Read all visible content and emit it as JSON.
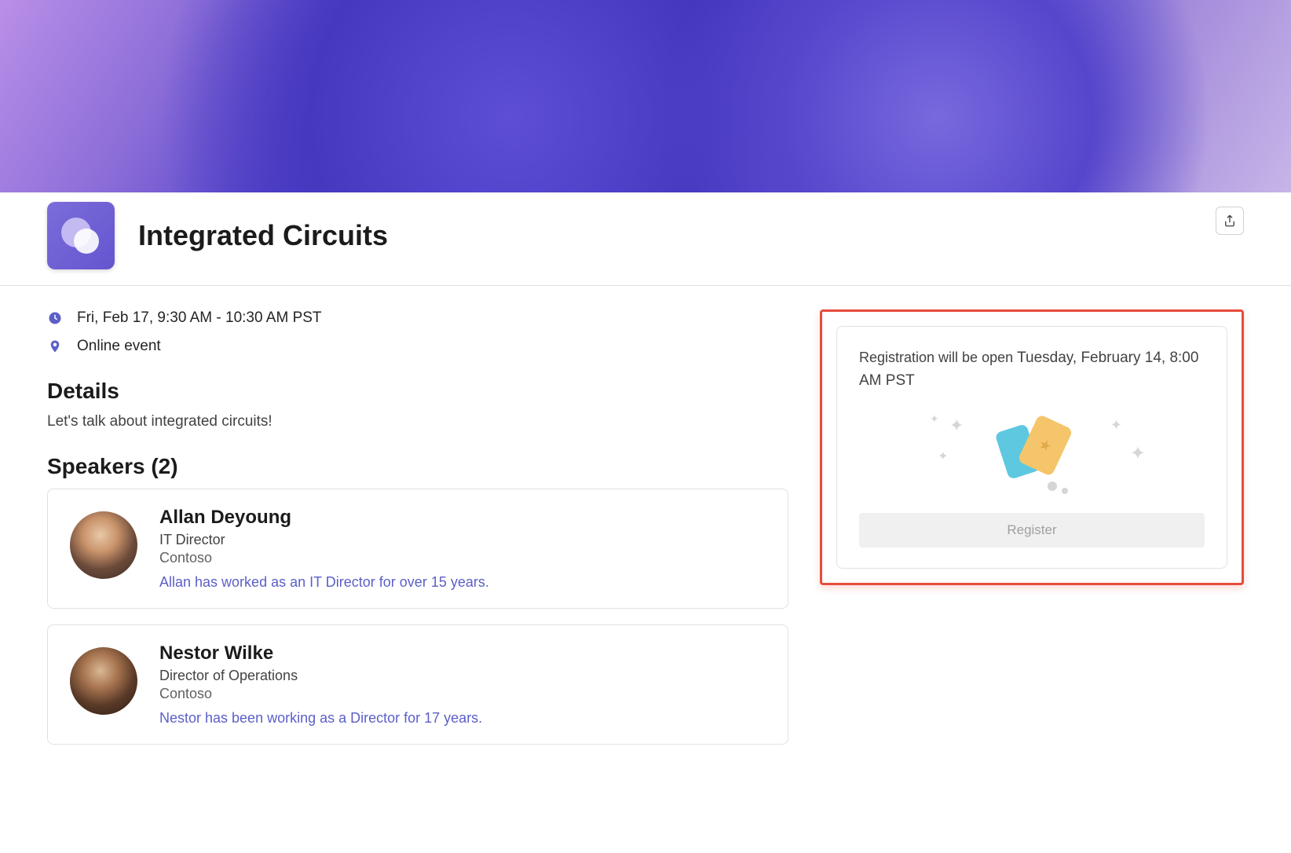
{
  "event": {
    "title": "Integrated Circuits",
    "datetime": "Fri, Feb 17, 9:30 AM - 10:30 AM PST",
    "location": "Online event"
  },
  "headings": {
    "details": "Details",
    "speakers": "Speakers (2)"
  },
  "details": {
    "description": "Let's talk about integrated circuits!"
  },
  "speakers": [
    {
      "name": "Allan Deyoung",
      "role": "IT Director",
      "company": "Contoso",
      "bio": "Allan has worked as an IT Director for over 15 years."
    },
    {
      "name": "Nestor Wilke",
      "role": "Director of Operations",
      "company": "Contoso",
      "bio": "Nestor has been working as a Director for 17 years."
    }
  ],
  "registration": {
    "prefix": "Registration will be open ",
    "open_date": "Tuesday, February 14, 8:00 AM PST",
    "button_label": "Register"
  }
}
